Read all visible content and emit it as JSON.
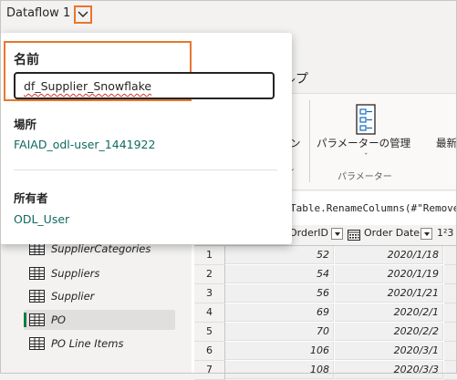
{
  "title_bar": {
    "app_title": "Dataflow 1",
    "chevron_icon": "chevron-down-icon"
  },
  "ribbon": {
    "help_tab_partial": "ルプ",
    "partial_left_label": "ン",
    "partial_left_caret": "ˇ",
    "params_button_label": "パラメーターの管理",
    "params_caret": "ˇ",
    "params_group_label": "パラメーター",
    "partial_right_label": "最新"
  },
  "formula_bar": {
    "formula_text": "Table.RenameColumns(#\"Remove"
  },
  "flyout": {
    "name_label": "名前",
    "name_value": "df_Supplier_Snowflake",
    "location_label": "場所",
    "location_value": "FAIAD_odl-user_1441922",
    "owner_label": "所有者",
    "owner_value": "ODL_User"
  },
  "queries": [
    {
      "label": "SupplierCategories",
      "icon": "table-icon",
      "selected": false
    },
    {
      "label": "Suppliers",
      "icon": "table-icon",
      "selected": false
    },
    {
      "label": "Supplier",
      "icon": "table-icon",
      "selected": false
    },
    {
      "label": "PO",
      "icon": "table-icon",
      "selected": true
    },
    {
      "label": "PO Line Items",
      "icon": "table-icon",
      "selected": false
    }
  ],
  "grid": {
    "columns": [
      {
        "label": "OrderID",
        "type_icon": "",
        "has_filter": true
      },
      {
        "label": "Order Date",
        "type_icon": "calendar-icon",
        "has_filter": true
      },
      {
        "label": "1²3",
        "type_icon": "number-type-icon",
        "has_filter": false
      }
    ],
    "rows": [
      {
        "n": "1",
        "order_id": "52",
        "order_date": "2020/1/18"
      },
      {
        "n": "2",
        "order_id": "54",
        "order_date": "2020/1/19"
      },
      {
        "n": "3",
        "order_id": "56",
        "order_date": "2020/1/21"
      },
      {
        "n": "4",
        "order_id": "69",
        "order_date": "2020/2/1"
      },
      {
        "n": "5",
        "order_id": "70",
        "order_date": "2020/2/2"
      },
      {
        "n": "6",
        "order_id": "106",
        "order_date": "2020/3/1"
      },
      {
        "n": "7",
        "order_id": "108",
        "order_date": "2020/3/3"
      }
    ]
  },
  "colors": {
    "highlight": "#e8762d",
    "link": "#0f6a5f",
    "selection_bar": "#107c41"
  }
}
